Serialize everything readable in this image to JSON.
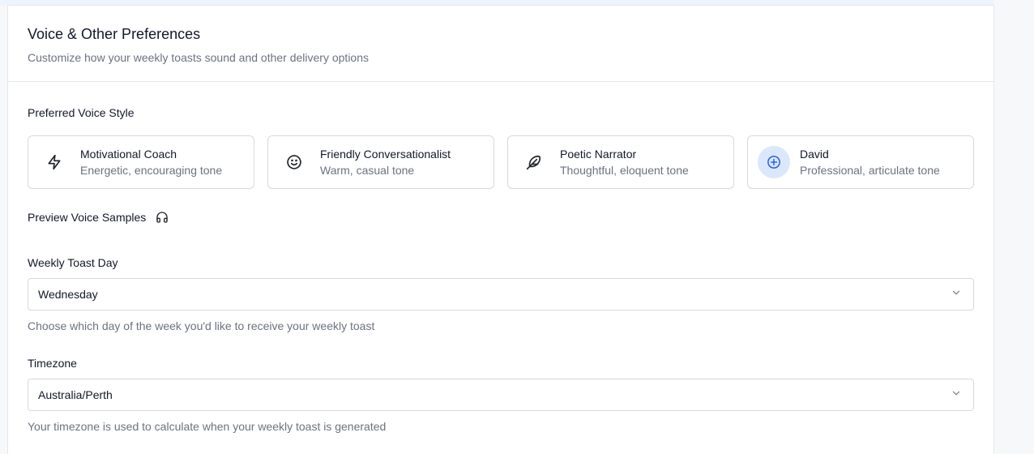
{
  "header": {
    "title": "Voice & Other Preferences",
    "subtitle": "Customize how your weekly toasts sound and other delivery options"
  },
  "voice": {
    "section_label": "Preferred Voice Style",
    "options": [
      {
        "name": "Motivational Coach",
        "description": "Energetic, encouraging tone",
        "icon": "lightning-icon",
        "selected": false
      },
      {
        "name": "Friendly Conversationalist",
        "description": "Warm, casual tone",
        "icon": "smile-icon",
        "selected": false
      },
      {
        "name": "Poetic Narrator",
        "description": "Thoughtful, eloquent tone",
        "icon": "feather-icon",
        "selected": false
      },
      {
        "name": "David",
        "description": "Professional, articulate tone",
        "icon": "plus-circle-icon",
        "selected": true
      }
    ],
    "preview_label": "Preview Voice Samples",
    "preview_icon": "headphones-icon"
  },
  "weekly_day": {
    "label": "Weekly Toast Day",
    "value": "Wednesday",
    "helper": "Choose which day of the week you'd like to receive your weekly toast"
  },
  "timezone": {
    "label": "Timezone",
    "value": "Australia/Perth",
    "helper": "Your timezone is used to calculate when your weekly toast is generated"
  },
  "colors": {
    "accent": "#2563eb",
    "selected_bg": "#dbe7fb",
    "border": "#d6d9de",
    "muted_text": "#6b7280"
  }
}
